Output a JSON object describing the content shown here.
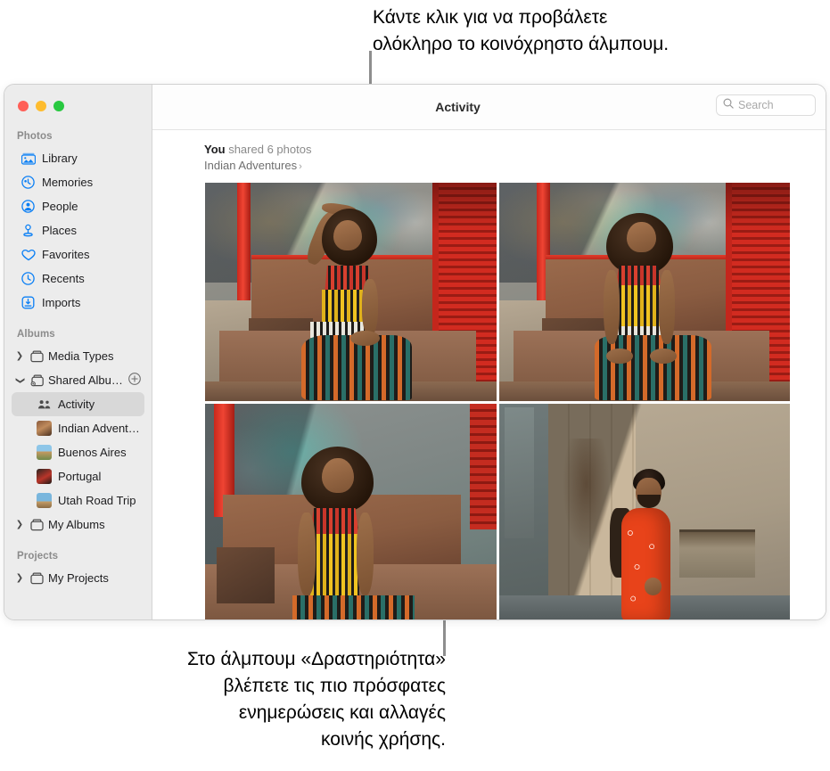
{
  "callouts": {
    "top": "Κάντε κλικ για να προβάλετε\nολόκληρο το κοινόχρηστο άλμπουμ.",
    "bottom": "Στο άλμπουμ «Δραστηριότητα»\nβλέπετε τις πιο πρόσφατες\nενημερώσεις και αλλαγές\nκοινής χρήσης."
  },
  "window": {
    "traffic_lights": [
      {
        "name": "close",
        "color": "#FF5F57"
      },
      {
        "name": "minimize",
        "color": "#FEBC2E"
      },
      {
        "name": "zoom",
        "color": "#28C840"
      }
    ]
  },
  "toolbar": {
    "title": "Activity",
    "search": {
      "placeholder": "Search",
      "value": "",
      "icon": "search-icon"
    }
  },
  "sidebar": {
    "sections": [
      {
        "title": "Photos",
        "items": [
          {
            "label": "Library",
            "icon": "library-icon",
            "selected": false
          },
          {
            "label": "Memories",
            "icon": "memories-icon",
            "selected": false
          },
          {
            "label": "People",
            "icon": "people-icon",
            "selected": false
          },
          {
            "label": "Places",
            "icon": "places-icon",
            "selected": false
          },
          {
            "label": "Favorites",
            "icon": "heart-icon",
            "selected": false
          },
          {
            "label": "Recents",
            "icon": "clock-icon",
            "selected": false
          },
          {
            "label": "Imports",
            "icon": "import-icon",
            "selected": false
          }
        ]
      },
      {
        "title": "Albums",
        "groups": [
          {
            "label": "Media Types",
            "disclosure": "collapsed",
            "icon": "folder-icon"
          },
          {
            "label": "Shared Albu…",
            "disclosure": "expanded",
            "icon": "shared-folder-icon",
            "add_button": "add-shared-album-button"
          }
        ],
        "shared_albums": [
          {
            "label": "Activity",
            "icon": "people-pair-icon",
            "selected": true
          },
          {
            "label": "Indian Advent…",
            "thumb": "tIndian",
            "selected": false
          },
          {
            "label": "Buenos Aires",
            "thumb": "tBA",
            "selected": false
          },
          {
            "label": "Portugal",
            "thumb": "tPort",
            "selected": false
          },
          {
            "label": "Utah Road Trip",
            "thumb": "tUtah",
            "selected": false
          }
        ],
        "my_albums": {
          "label": "My Albums",
          "disclosure": "collapsed",
          "icon": "folder-icon"
        }
      },
      {
        "title": "Projects",
        "my_projects": {
          "label": "My Projects",
          "disclosure": "collapsed",
          "icon": "folder-icon"
        }
      }
    ]
  },
  "activity": {
    "actor": "You",
    "action": " shared 6 photos",
    "album": "Indian Adventures",
    "chevron": "›",
    "photos": [
      {
        "name": "photo-woman-hand-on-head",
        "alt": "Woman in striped dress sitting, hand raised to head"
      },
      {
        "name": "photo-woman-seated-facing",
        "alt": "Woman in striped dress seated facing camera"
      },
      {
        "name": "photo-woman-eyes-closed",
        "alt": "Woman in striped dress, eyes closed"
      },
      {
        "name": "photo-man-orange-shirt",
        "alt": "Man in orange shirt by weathered doors"
      }
    ]
  },
  "colors": {
    "accent_blue": "#0A7FF5",
    "sidebar_bg": "#ECECEC",
    "selected_row": "#D8D8D8",
    "leader_line": "#8E8E8E"
  }
}
